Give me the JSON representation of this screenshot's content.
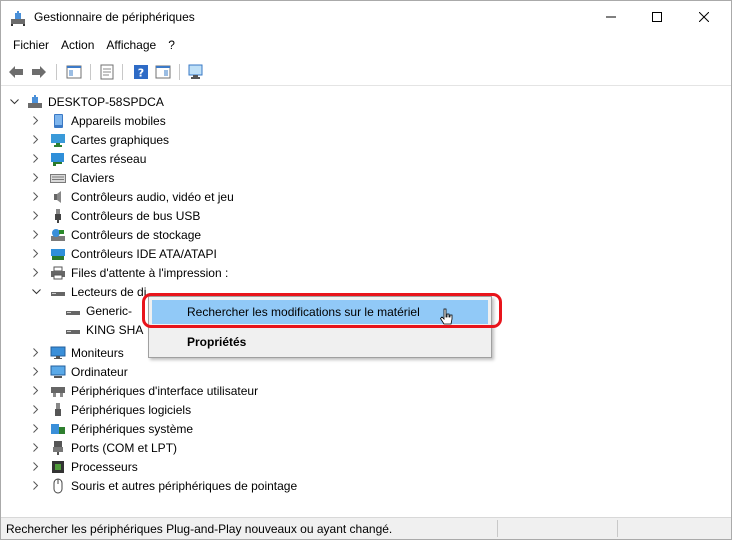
{
  "window": {
    "title": "Gestionnaire de périphériques",
    "icon": "device-manager-icon"
  },
  "menu": {
    "items": [
      "Fichier",
      "Action",
      "Affichage",
      "?"
    ]
  },
  "toolbar": {
    "icons": [
      "back-arrow-icon",
      "forward-arrow-icon",
      "show-hide-tree-icon",
      "properties-icon",
      "help-icon",
      "console-view-icon",
      "scan-hardware-icon"
    ]
  },
  "tree": {
    "root": "DESKTOP-58SPDCA",
    "categories": [
      "Appareils mobiles",
      "Cartes graphiques",
      "Cartes réseau",
      "Claviers",
      "Contrôleurs audio, vidéo et jeu",
      "Contrôleurs de bus USB",
      "Contrôleurs de stockage",
      "Contrôleurs IDE ATA/ATAPI",
      "Files d'attente à l'impression :",
      "Lecteurs de di",
      "Moniteurs",
      "Ordinateur",
      "Périphériques d'interface utilisateur",
      "Périphériques logiciels",
      "Périphériques système",
      "Ports (COM et LPT)",
      "Processeurs",
      "Souris et autres périphériques de pointage"
    ],
    "disk_children": [
      "Generic-",
      "KING SHA"
    ]
  },
  "context_menu": {
    "scan_label": "Rechercher les modifications sur le matériel",
    "properties_label": "Propriétés"
  },
  "status": {
    "text": "Rechercher les périphériques Plug-and-Play nouveaux ou ayant changé."
  },
  "colors": {
    "highlight": "#91c9f7",
    "annotation": "#e8141b"
  }
}
